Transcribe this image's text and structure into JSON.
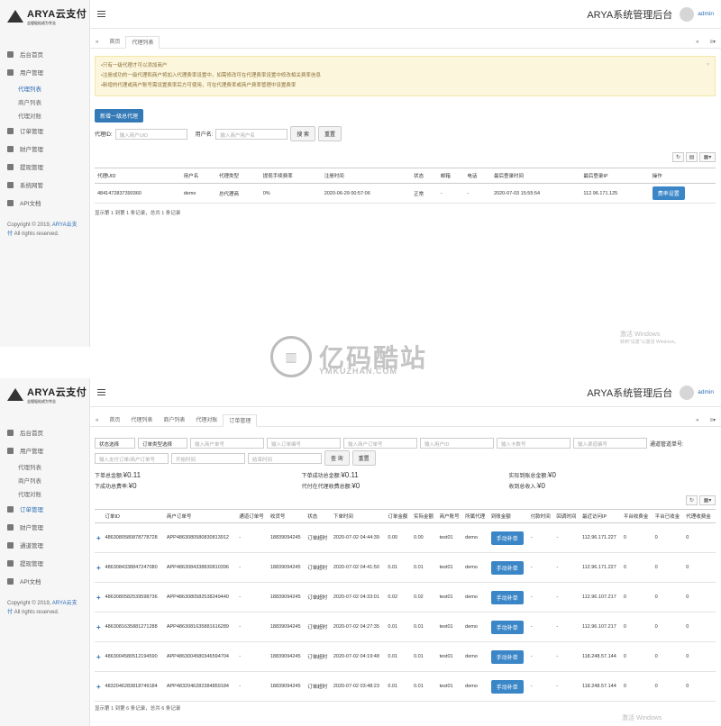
{
  "brand": {
    "logo": "ARYA云支付",
    "logo_sub": "全程轻松成为专业"
  },
  "header": {
    "title": "ARYA系统管理后台",
    "user": "admin"
  },
  "sidebar1": {
    "items": [
      {
        "label": "后台首页"
      },
      {
        "label": "用户管理"
      },
      {
        "label": "代理列表",
        "sub": true,
        "active": true
      },
      {
        "label": "商户列表",
        "sub": true
      },
      {
        "label": "代理对账",
        "sub": true
      },
      {
        "label": "订单管理"
      },
      {
        "label": "财户管理"
      },
      {
        "label": "提现管理"
      },
      {
        "label": "系统网管"
      },
      {
        "label": "API文档"
      }
    ],
    "copyright": "Copyright © 2019, ",
    "copyright_link": "ARYA云支付",
    "copyright_rest": " All rights reserved."
  },
  "tabs1": [
    "首页",
    "代理列表"
  ],
  "alert": {
    "lines": [
      "•只有一级代理才可以添加商户",
      "•注册成功的一级代理和商户将加入代理费率设置中，如需修改可在代理费率设置中修改相关费率信息",
      "•新增的代理或商户账号需设置费率后方可使用，可在代理费率或商户费率管理中设置费率"
    ]
  },
  "agents": {
    "add_btn": "新增一级总代理",
    "filter": {
      "agent_id_label": "代理ID:",
      "agent_id_ph": "输入商户UID",
      "user_label": "用户名:",
      "user_ph": "输入商户用户名",
      "search": "搜 索",
      "reset": "重置"
    },
    "columns": [
      "代理UID",
      "用户名",
      "代理类型",
      "提现手续费率",
      "注册时间",
      "状态",
      "邮箱",
      "电话",
      "最后登录时间",
      "最后登录IP",
      "操作"
    ],
    "rows": [
      {
        "uid": "4841472837390360",
        "user": "demo",
        "type": "总代理商",
        "rate": "0%",
        "reg": "2020-06-29 00:57:06",
        "status": "正常",
        "email": "-",
        "phone": "-",
        "last": "2020-07-03 15:55:54",
        "ip": "112.96.171.125",
        "op": "费率设置"
      }
    ],
    "footer": "显示第 1 到第 1 条记录，总共 1 条记录"
  },
  "sidebar2": {
    "items": [
      {
        "label": "后台首页"
      },
      {
        "label": "用户管理"
      },
      {
        "label": "代理列表",
        "sub": true
      },
      {
        "label": "商户列表",
        "sub": true
      },
      {
        "label": "代理对账",
        "sub": true
      },
      {
        "label": "订单管理",
        "active": true
      },
      {
        "label": "财户管理"
      },
      {
        "label": "通道管理"
      },
      {
        "label": "提现管理"
      },
      {
        "label": "API文档"
      }
    ]
  },
  "tabs2": [
    "首页",
    "代理列表",
    "商户列表",
    "代理对账",
    "订单管理"
  ],
  "orders": {
    "filter": {
      "sel1": "状态选择",
      "sel2": "订单类型选择",
      "ph": [
        "输入商户单号",
        "输入订单编号",
        "输入商户订单号",
        "输入用户ID",
        "输入卡数号",
        "输入渠道编号"
      ],
      "ph2": [
        "输入支付订单/商户订单号",
        "开始时间",
        "结束时间"
      ],
      "search": "查 询",
      "reset": "重置",
      "label": "通道管道单号:"
    },
    "stats": [
      {
        "k": "下单总金额:",
        "v": "¥0.11"
      },
      {
        "k": "下单成功总金额:",
        "v": "¥0.11"
      },
      {
        "k": "实际到账总金额:",
        "v": "¥0"
      },
      {
        "k": "下成功总费率:",
        "v": "¥0"
      },
      {
        "k": "代付在代理收费总额:",
        "v": "¥0"
      },
      {
        "k": "收到总收入:",
        "v": "¥0"
      }
    ],
    "columns": [
      "",
      "订单ID",
      "商户订单号",
      "通道订单号",
      "收货号",
      "状态",
      "下单时间",
      "订单金额",
      "实际金额",
      "商户账号",
      "所属代理",
      "到账金额",
      "付款时间",
      "回调时间",
      "最近访问IP",
      "平台收费金",
      "平台已收金",
      "代理收费金"
    ],
    "rows": [
      {
        "id": "4863080580878778728",
        "mo": "APP4863080580830813912",
        "ch": "-",
        "rcv": "18839094245",
        "st": "订单超时",
        "t": "2020-07-02 04:44:39",
        "amt": "0.00",
        "real": "0.00",
        "acc": "test01",
        "agent": "demo",
        "btn": "手动补单",
        "pay": "-",
        "cb": "-",
        "ip": "112.96.171.227",
        "a": "0",
        "b": "0",
        "c": "0"
      },
      {
        "id": "4863084338847247080",
        "mo": "APP4863084338830810396",
        "ch": "-",
        "rcv": "18839094245",
        "st": "订单超时",
        "t": "2020-07-02 04:41:50",
        "amt": "0.01",
        "real": "0.01",
        "acc": "test01",
        "agent": "demo",
        "btn": "手动补单",
        "pay": "-",
        "cb": "-",
        "ip": "112.96.171.227",
        "a": "0",
        "b": "0",
        "c": "0"
      },
      {
        "id": "4863080582539598736",
        "mo": "APP4863080582538249440",
        "ch": "-",
        "rcv": "18839094245",
        "st": "订单超时",
        "t": "2020-07-02 04:33:01",
        "amt": "0.02",
        "real": "0.02",
        "acc": "test01",
        "agent": "demo",
        "btn": "手动补单",
        "pay": "-",
        "cb": "-",
        "ip": "112.96.107.217",
        "a": "0",
        "b": "0",
        "c": "0"
      },
      {
        "id": "4863081635881271288",
        "mo": "APP4863081635881616289",
        "ch": "-",
        "rcv": "18839094245",
        "st": "订单超时",
        "t": "2020-07-02 04:27:35",
        "amt": "0.01",
        "real": "0.01",
        "acc": "test01",
        "agent": "demo",
        "btn": "手动补单",
        "pay": "-",
        "cb": "-",
        "ip": "112.96.107.217",
        "a": "0",
        "b": "0",
        "c": "0"
      },
      {
        "id": "4863004580512194590",
        "mo": "APP4863004580346594704",
        "ch": "-",
        "rcv": "18839094245",
        "st": "订单超时",
        "t": "2020-07-02 04:19:48",
        "amt": "0.01",
        "real": "0.01",
        "acc": "test01",
        "agent": "demo",
        "btn": "手动补单",
        "pay": "-",
        "cb": "-",
        "ip": "118.248.57.144",
        "a": "0",
        "b": "0",
        "c": "0"
      },
      {
        "id": "4832046283818749184",
        "mo": "APP4832046282384859184",
        "ch": "-",
        "rcv": "18839094245",
        "st": "订单超时",
        "t": "2020-07-02 03:48:23",
        "amt": "0.01",
        "real": "0.01",
        "acc": "test01",
        "agent": "demo",
        "btn": "手动补单",
        "pay": "-",
        "cb": "-",
        "ip": "118.248.57.144",
        "a": "0",
        "b": "0",
        "c": "0"
      }
    ],
    "footer": "显示第 1 到第 6 条记录，总共 6 条记录"
  },
  "watermark": {
    "cn": "亿码酷站",
    "en": "YMKUZHAN.COM",
    "win1": "激活 Windows",
    "win2": "转到\"设置\"以激活 Windows。"
  }
}
